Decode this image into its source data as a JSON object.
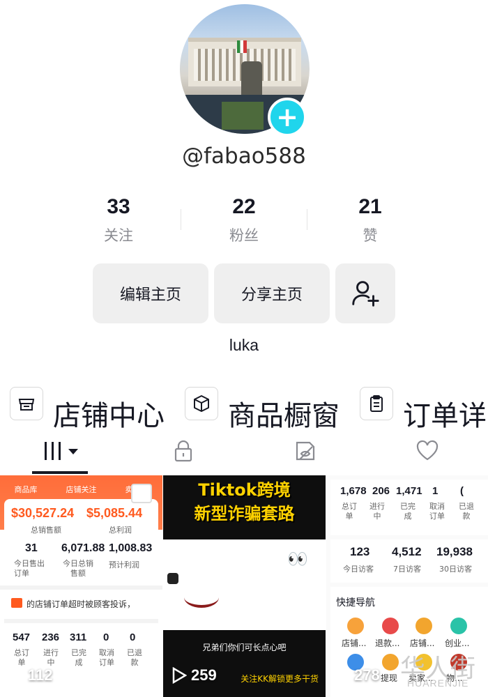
{
  "profile": {
    "username": "@fabao588",
    "bio": "luka",
    "stats": [
      {
        "value": "33",
        "label": "关注"
      },
      {
        "value": "22",
        "label": "粉丝"
      },
      {
        "value": "21",
        "label": "赞"
      }
    ],
    "buttons": {
      "edit": "编辑主页",
      "share": "分享主页"
    }
  },
  "shortcuts": [
    {
      "label": "店铺中心",
      "icon": "store-icon"
    },
    {
      "label": "商品橱窗",
      "icon": "box-icon"
    },
    {
      "label": "订单详",
      "icon": "clipboard-icon"
    }
  ],
  "tabs": [
    {
      "name": "videos-grid",
      "icon": "grid-icon"
    },
    {
      "name": "private",
      "icon": "lock-icon"
    },
    {
      "name": "hidden",
      "icon": "eye-slash-icon"
    },
    {
      "name": "liked",
      "icon": "heart-icon"
    }
  ],
  "videos": [
    {
      "views": "112",
      "top_tabs": [
        "商品库",
        "店铺关注",
        "卖家信"
      ],
      "sales_total": "$30,527.24",
      "sales_total_label": "总销售额",
      "profit_total": "$5,085.44",
      "profit_total_label": "总利润",
      "today_orders": "31",
      "today_orders_label": "今日售出订单",
      "today_sales": "6,071.88",
      "today_sales_label": "今日总销售额",
      "expected_profit": "1,008.83",
      "expected_profit_label": "预计利润",
      "notice": "的店铺订单超时被顾客投诉，",
      "bottom_stats": [
        {
          "value": "547",
          "label": "总订单"
        },
        {
          "value": "236",
          "label": "进行中"
        },
        {
          "value": "311",
          "label": "已完成"
        },
        {
          "value": "0",
          "label": "取消订单"
        },
        {
          "value": "0",
          "label": "已退款"
        }
      ]
    },
    {
      "views": "259",
      "title_line1": "Tiktok跨境",
      "title_line2": "新型诈骗套路",
      "subtitle": "兄弟们你们可长点心吧",
      "footer": "关注KK解锁更多干货"
    },
    {
      "views": "278",
      "top_stats": [
        {
          "value": "1,678",
          "label": "总订单"
        },
        {
          "value": "206",
          "label": "进行中"
        },
        {
          "value": "1,471",
          "label": "已完成"
        },
        {
          "value": "1",
          "label": "取消订单"
        },
        {
          "value": "(",
          "label": "已退款"
        }
      ],
      "visitors": [
        {
          "value": "123",
          "label": "今日访客"
        },
        {
          "value": "4,512",
          "label": "7日访客"
        },
        {
          "value": "19,938",
          "label": "30日访客"
        }
      ],
      "nav_title": "快捷导航",
      "nav_items": [
        "店铺...",
        "退款...",
        "店铺...",
        "创业..."
      ],
      "nav_items2": [
        "提现",
        "卖家...",
        "物..."
      ]
    }
  ],
  "watermark": {
    "cn": "华人街",
    "en": "HUARENJIE"
  }
}
